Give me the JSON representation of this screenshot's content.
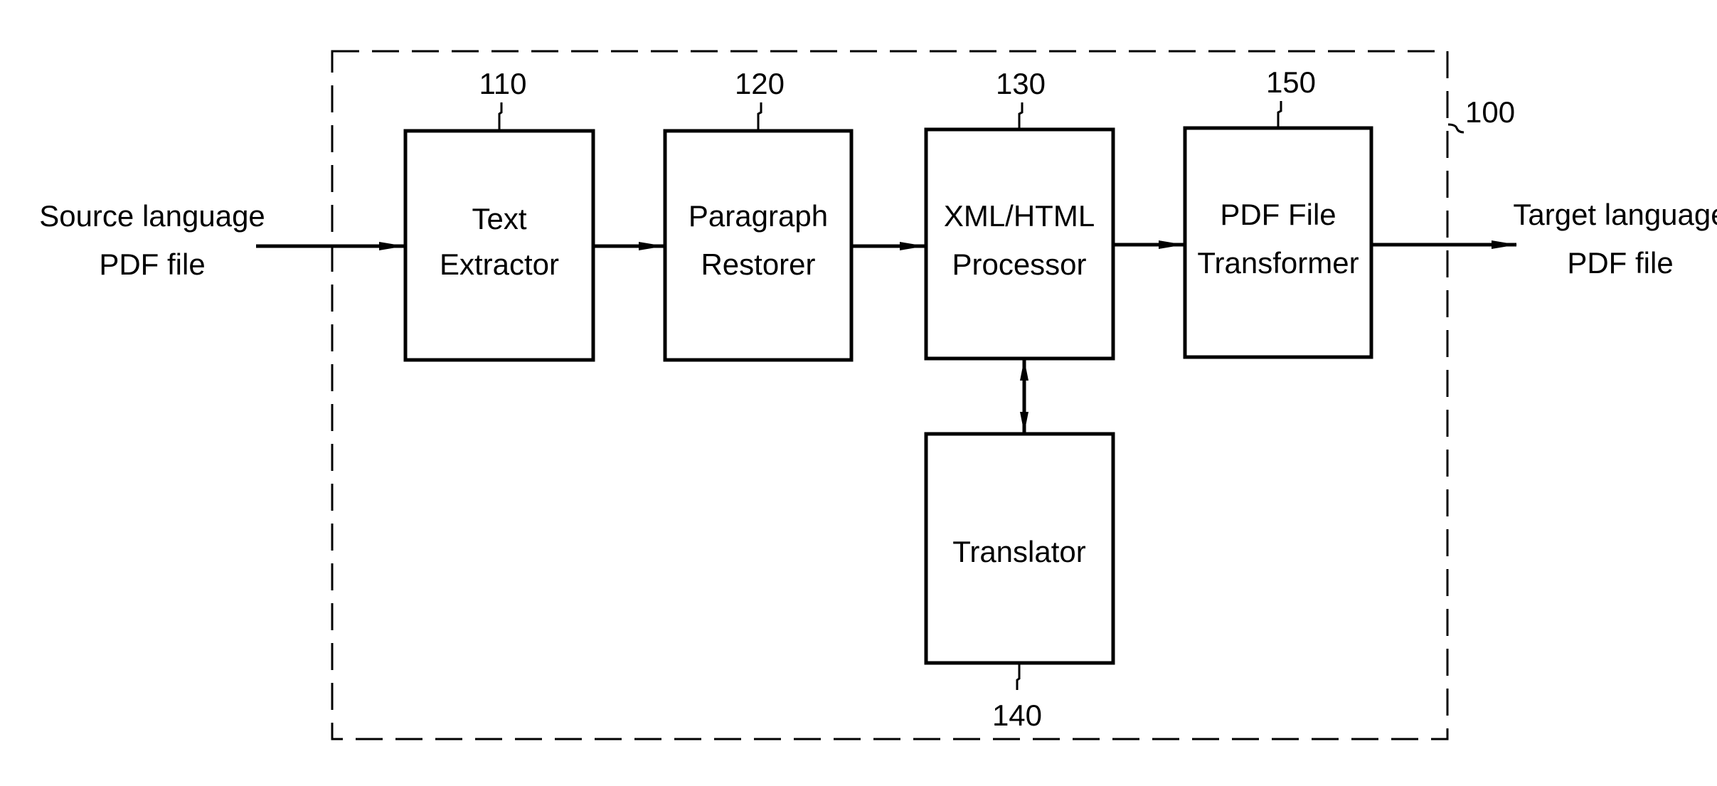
{
  "diagram": {
    "system_ref": "100",
    "input": {
      "lines": [
        "Source language",
        "PDF file"
      ]
    },
    "output": {
      "lines": [
        "Target language",
        "PDF file"
      ]
    },
    "blocks": [
      {
        "id": "text-extractor",
        "ref": "110",
        "lines": [
          "Text",
          "Extractor"
        ]
      },
      {
        "id": "paragraph-restorer",
        "ref": "120",
        "lines": [
          "Paragraph",
          "Restorer"
        ]
      },
      {
        "id": "xml-html-processor",
        "ref": "130",
        "lines": [
          "XML/HTML",
          "Processor"
        ]
      },
      {
        "id": "translator",
        "ref": "140",
        "lines": [
          "Translator"
        ]
      },
      {
        "id": "pdf-file-transformer",
        "ref": "150",
        "lines": [
          "PDF File",
          "Transformer"
        ]
      }
    ],
    "connections": [
      {
        "from": "input",
        "to": "text-extractor",
        "type": "arrow"
      },
      {
        "from": "text-extractor",
        "to": "paragraph-restorer",
        "type": "arrow"
      },
      {
        "from": "paragraph-restorer",
        "to": "xml-html-processor",
        "type": "arrow"
      },
      {
        "from": "xml-html-processor",
        "to": "pdf-file-transformer",
        "type": "arrow"
      },
      {
        "from": "xml-html-processor",
        "to": "translator",
        "type": "bidirectional"
      },
      {
        "from": "pdf-file-transformer",
        "to": "output",
        "type": "arrow"
      }
    ]
  }
}
